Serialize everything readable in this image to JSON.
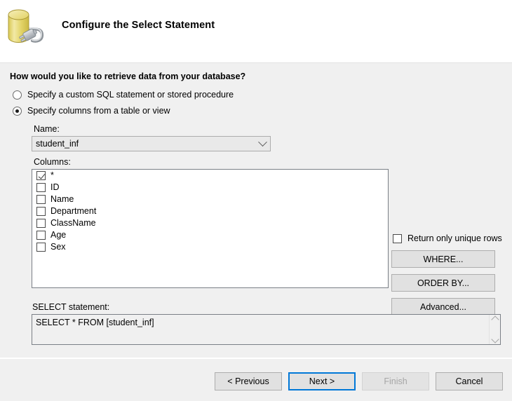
{
  "header": {
    "title": "Configure the Select Statement",
    "icon": "database-connection-icon"
  },
  "main": {
    "prompt": "How would you like to retrieve data from your database?",
    "radio_options": [
      {
        "label": "Specify a custom SQL statement or stored procedure",
        "selected": false
      },
      {
        "label": "Specify columns from a table or view",
        "selected": true
      }
    ],
    "name_label": "Name:",
    "name_value": "student_inf",
    "columns_label": "Columns:",
    "columns": [
      {
        "label": "*",
        "checked": true
      },
      {
        "label": "ID",
        "checked": false
      },
      {
        "label": "Name",
        "checked": false
      },
      {
        "label": "Department",
        "checked": false
      },
      {
        "label": "ClassName",
        "checked": false
      },
      {
        "label": "Age",
        "checked": false
      },
      {
        "label": "Sex",
        "checked": false
      }
    ],
    "unique_rows_label": "Return only unique rows",
    "unique_rows_checked": false,
    "side_buttons": [
      {
        "label": "WHERE..."
      },
      {
        "label": "ORDER BY..."
      },
      {
        "label": "Advanced..."
      }
    ],
    "select_statement_label": "SELECT statement:",
    "select_statement_value": "SELECT * FROM [student_inf]"
  },
  "footer": {
    "previous_label": "< Previous",
    "next_label": "Next >",
    "finish_label": "Finish",
    "cancel_label": "Cancel"
  },
  "colors": {
    "body_background": "#f0f0f0",
    "header_background": "#ffffff",
    "focus_accent": "#0078d7",
    "button_face": "#e1e1e1",
    "disabled_text": "#a6a6a6",
    "icon_yellow": "#e8d96a",
    "icon_gray": "#b9bcc0"
  }
}
